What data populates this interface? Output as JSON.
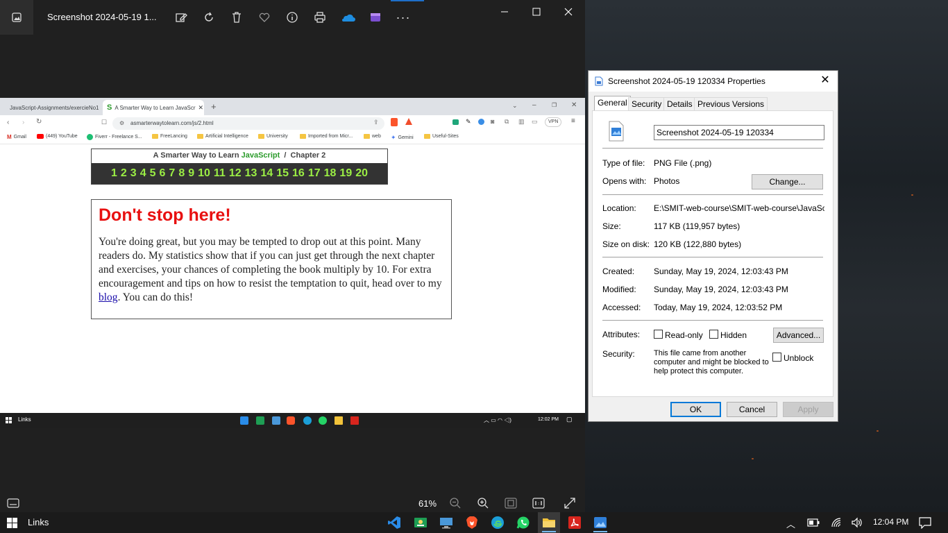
{
  "photos": {
    "title": "Screenshot 2024-05-19 1...",
    "zoom": "61%",
    "toolbar_icons": [
      "edit-icon",
      "rotate-icon",
      "delete-icon",
      "favorite-icon",
      "info-icon",
      "print-icon",
      "onedrive-icon",
      "clipchamp-icon",
      "more-icon"
    ]
  },
  "browser": {
    "tabs": [
      {
        "label": "JavaScript-Assignments/exercieNo1"
      },
      {
        "label": "A Smarter Way to Learn JavaScr"
      }
    ],
    "url": "asmarterwaytolearn.com/js/2.html",
    "vpn": "VPN",
    "bookmarks": [
      "Gmail",
      "(449) YouTube",
      "Fiverr - Freelance S...",
      "FreeLancing",
      "Artificial Intelligence",
      "University",
      "Imported from Micr...",
      "web",
      "Gemini",
      "Useful-Sites"
    ]
  },
  "webpage": {
    "nav_prefix": "A Smarter Way to Learn ",
    "nav_js": "JavaScript",
    "nav_suffix": "  /  Chapter 2",
    "chapters": [
      "1",
      "2",
      "3",
      "4",
      "5",
      "6",
      "7",
      "8",
      "9",
      "10",
      "11",
      "12",
      "13",
      "14",
      "15",
      "16",
      "17",
      "18",
      "19",
      "20"
    ],
    "heading": "Don't stop here!",
    "body_before": "You're doing great, but you may be tempted to drop out at this point. Many readers do. My statistics show that if you can just get through the next chapter and exercises, your chances of completing the book multiply by 10. For extra encouragement and tips on how to resist the temptation to quit, head over to my ",
    "link": "blog",
    "body_after": ". You can do this!"
  },
  "inner_taskbar": {
    "label": "Links",
    "time": "12:02 PM"
  },
  "dialog": {
    "title": "Screenshot 2024-05-19 120334 Properties",
    "tabs": [
      "General",
      "Security",
      "Details",
      "Previous Versions"
    ],
    "filename": "Screenshot 2024-05-19 120334",
    "type_label": "Type of file:",
    "type_value": "PNG File (.png)",
    "opens_label": "Opens with:",
    "opens_value": "Photos",
    "change_btn": "Change...",
    "location_label": "Location:",
    "location_value": "E:\\SMIT-web-course\\SMIT-web-course\\JavaScript\\",
    "size_label": "Size:",
    "size_value": "117 KB (119,957 bytes)",
    "sod_label": "Size on disk:",
    "sod_value": "120 KB (122,880 bytes)",
    "created_label": "Created:",
    "created_value": "Sunday, May 19, 2024, 12:03:43 PM",
    "modified_label": "Modified:",
    "modified_value": "Sunday, May 19, 2024, 12:03:43 PM",
    "accessed_label": "Accessed:",
    "accessed_value": "Today, May 19, 2024, 12:03:52 PM",
    "attr_label": "Attributes:",
    "readonly": "Read-only",
    "hidden": "Hidden",
    "advanced_btn": "Advanced...",
    "security_label": "Security:",
    "security_text": "This file came from another computer and might be blocked to help protect this computer.",
    "unblock": "Unblock",
    "ok": "OK",
    "cancel": "Cancel",
    "apply": "Apply"
  },
  "taskbar": {
    "label": "Links",
    "time": "12:04 PM"
  }
}
